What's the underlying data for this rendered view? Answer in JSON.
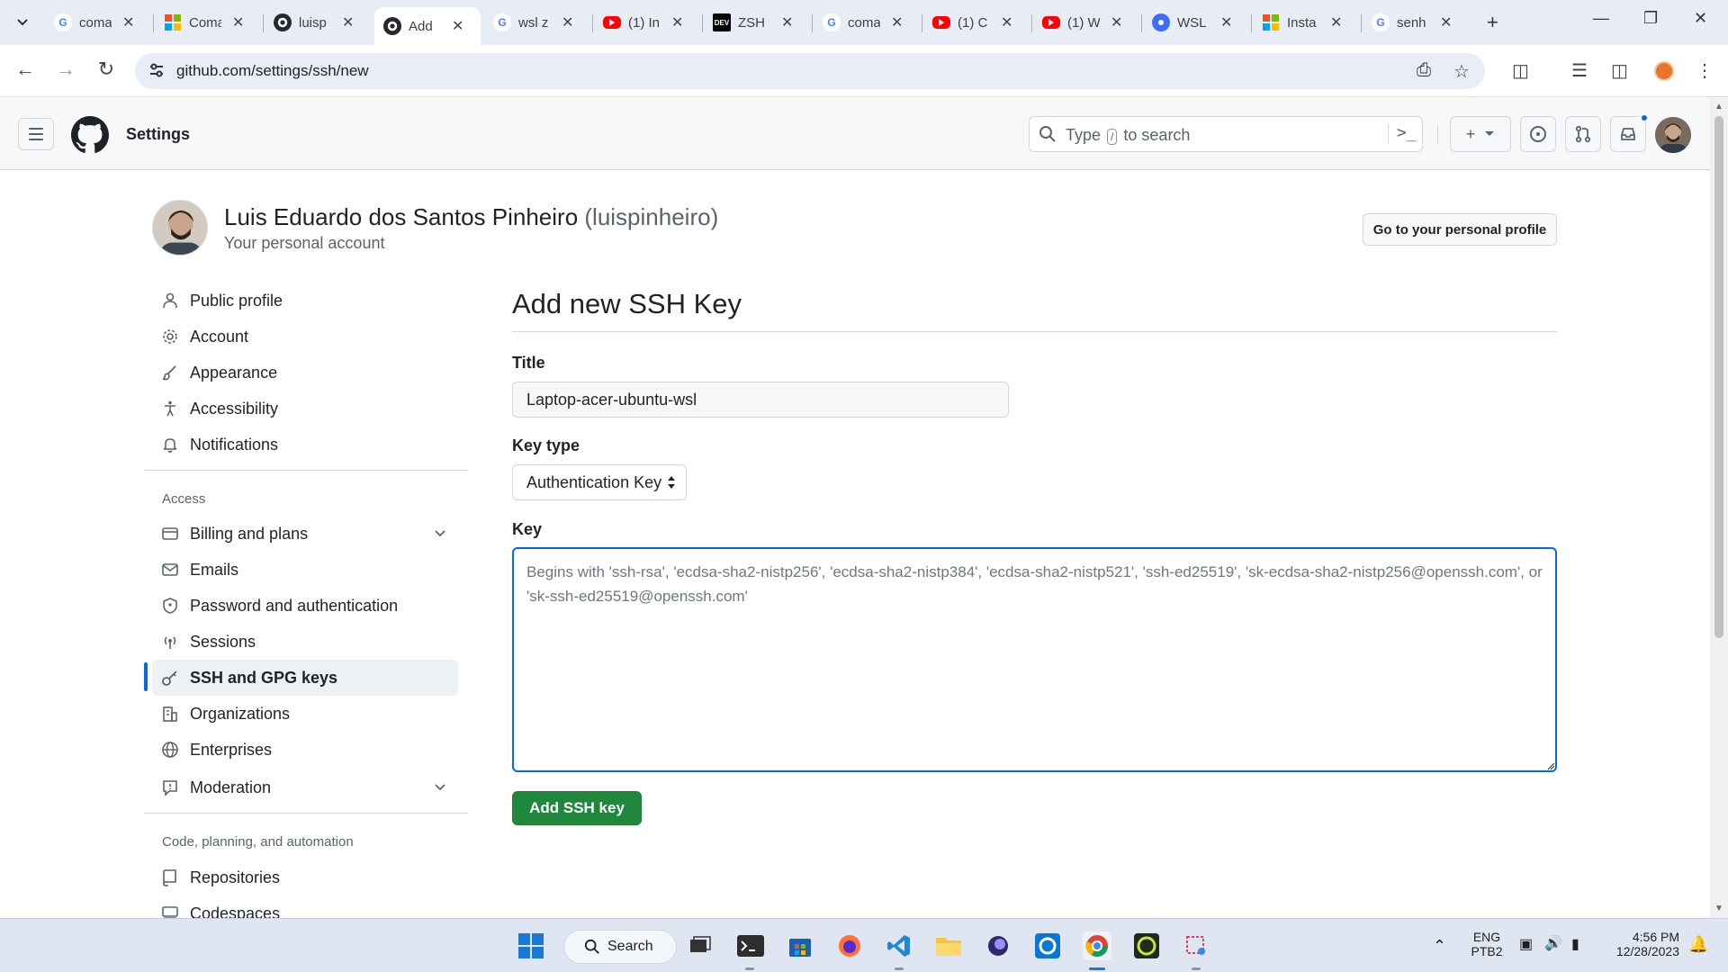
{
  "browser": {
    "tabs": [
      {
        "label": "coma",
        "fav": "G",
        "favColor": "#4285f4"
      },
      {
        "label": "Coma",
        "fav": "ms",
        "favColor": "#f25022"
      },
      {
        "label": "luisp",
        "fav": "gh",
        "favColor": "#24292f"
      },
      {
        "label": "Add",
        "fav": "gh",
        "favColor": "#24292f",
        "active": true
      },
      {
        "label": "wsl z",
        "fav": "G",
        "favColor": "#4285f4"
      },
      {
        "label": "(1) In",
        "fav": "yt",
        "favColor": "#ff0000"
      },
      {
        "label": "ZSH",
        "fav": "DEV",
        "favColor": "#000000"
      },
      {
        "label": "coma",
        "fav": "G",
        "favColor": "#4285f4"
      },
      {
        "label": "(1) C",
        "fav": "yt",
        "favColor": "#ff0000"
      },
      {
        "label": "(1) W",
        "fav": "yt",
        "favColor": "#ff0000"
      },
      {
        "label": "WSL",
        "fav": "w",
        "favColor": "#3b6df6"
      },
      {
        "label": "Insta",
        "fav": "ms",
        "favColor": "#f25022"
      },
      {
        "label": "senh",
        "fav": "G",
        "favColor": "#4285f4"
      }
    ],
    "url": "github.com/settings/ssh/new"
  },
  "header": {
    "title": "Settings",
    "search_placeholder_pre": "Type",
    "search_key": "/",
    "search_placeholder_post": "to search"
  },
  "profile": {
    "name": "Luis Eduardo dos Santos Pinheiro",
    "handle": "(luispinheiro)",
    "subtitle": "Your personal account",
    "go_profile_label": "Go to your personal profile"
  },
  "sidebar": {
    "items_top": [
      {
        "label": "Public profile",
        "icon": "person-icon"
      },
      {
        "label": "Account",
        "icon": "gear-icon"
      },
      {
        "label": "Appearance",
        "icon": "paintbrush-icon"
      },
      {
        "label": "Accessibility",
        "icon": "accessibility-icon"
      },
      {
        "label": "Notifications",
        "icon": "bell-icon"
      }
    ],
    "access_heading": "Access",
    "items_access": [
      {
        "label": "Billing and plans",
        "icon": "credit-card-icon",
        "expandable": true
      },
      {
        "label": "Emails",
        "icon": "mail-icon"
      },
      {
        "label": "Password and authentication",
        "icon": "shield-icon"
      },
      {
        "label": "Sessions",
        "icon": "broadcast-icon"
      },
      {
        "label": "SSH and GPG keys",
        "icon": "key-icon",
        "active": true
      },
      {
        "label": "Organizations",
        "icon": "organization-icon"
      },
      {
        "label": "Enterprises",
        "icon": "globe-icon"
      },
      {
        "label": "Moderation",
        "icon": "report-icon",
        "expandable": true
      }
    ],
    "code_heading": "Code, planning, and automation",
    "items_code": [
      {
        "label": "Repositories",
        "icon": "repo-icon"
      },
      {
        "label": "Codespaces",
        "icon": "codespaces-icon"
      }
    ]
  },
  "form": {
    "heading": "Add new SSH Key",
    "title_label": "Title",
    "title_value": "Laptop-acer-ubuntu-wsl",
    "keytype_label": "Key type",
    "keytype_value": "Authentication Key",
    "key_label": "Key",
    "key_placeholder": "Begins with 'ssh-rsa', 'ecdsa-sha2-nistp256', 'ecdsa-sha2-nistp384', 'ecdsa-sha2-nistp521', 'ssh-ed25519', 'sk-ecdsa-sha2-nistp256@openssh.com', or 'sk-ssh-ed25519@openssh.com'",
    "submit_label": "Add SSH key"
  },
  "taskbar": {
    "search_label": "Search",
    "lang_line1": "ENG",
    "lang_line2": "PTB2",
    "time": "4:56 PM",
    "date": "12/28/2023"
  },
  "colors": {
    "accent": "#0969da",
    "primary_button": "#1f883d"
  }
}
